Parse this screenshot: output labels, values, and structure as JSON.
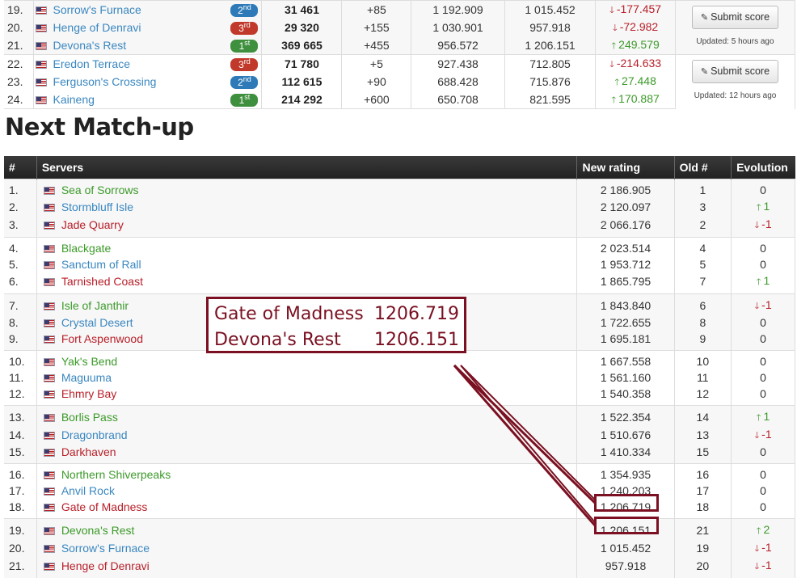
{
  "top_table": {
    "groups": [
      {
        "rows": [
          {
            "rank": "19.",
            "server": "Sorrow's Furnace",
            "color": "blue",
            "tier": "2",
            "tier_sup": "nd",
            "score": "31 461",
            "delta": "+85",
            "r1": "1 192.909",
            "r2": "1 015.452",
            "change": "-177.457",
            "dir": "down"
          },
          {
            "rank": "20.",
            "server": "Henge of Denravi",
            "color": "blue",
            "tier": "3",
            "tier_sup": "rd",
            "score": "29 320",
            "delta": "+155",
            "r1": "1 030.901",
            "r2": "957.918",
            "change": "-72.982",
            "dir": "down"
          },
          {
            "rank": "21.",
            "server": "Devona's Rest",
            "color": "blue",
            "tier": "1",
            "tier_sup": "st",
            "score": "369 665",
            "delta": "+455",
            "r1": "956.572",
            "r2": "1 206.151",
            "change": "249.579",
            "dir": "up"
          }
        ],
        "button": "Submit score",
        "updated": "Updated: 5 hours ago"
      },
      {
        "rows": [
          {
            "rank": "22.",
            "server": "Eredon Terrace",
            "color": "blue",
            "tier": "3",
            "tier_sup": "rd",
            "score": "71 780",
            "delta": "+5",
            "r1": "927.438",
            "r2": "712.805",
            "change": "-214.633",
            "dir": "down"
          },
          {
            "rank": "23.",
            "server": "Ferguson's Crossing",
            "color": "blue",
            "tier": "2",
            "tier_sup": "nd",
            "score": "112 615",
            "delta": "+90",
            "r1": "688.428",
            "r2": "715.876",
            "change": "27.448",
            "dir": "up"
          },
          {
            "rank": "24.",
            "server": "Kaineng",
            "color": "blue",
            "tier": "1",
            "tier_sup": "st",
            "score": "214 292",
            "delta": "+600",
            "r1": "650.708",
            "r2": "821.595",
            "change": "170.887",
            "dir": "up"
          }
        ],
        "button": "Submit score",
        "updated": "Updated: 12 hours ago"
      }
    ]
  },
  "next_matchup": {
    "title": "Next Match-up",
    "headers": {
      "num": "#",
      "servers": "Servers",
      "new_rating": "New rating",
      "old": "Old #",
      "evolution": "Evolution"
    },
    "groups": [
      [
        {
          "n": "1.",
          "server": "Sea of Sorrows",
          "color": "green",
          "rating": "2 186.905",
          "old": "1",
          "evo": "0",
          "dir": ""
        },
        {
          "n": "2.",
          "server": "Stormbluff Isle",
          "color": "blue",
          "rating": "2 120.097",
          "old": "3",
          "evo": "1",
          "dir": "up"
        },
        {
          "n": "3.",
          "server": "Jade Quarry",
          "color": "red",
          "rating": "2 066.176",
          "old": "2",
          "evo": "-1",
          "dir": "down"
        }
      ],
      [
        {
          "n": "4.",
          "server": "Blackgate",
          "color": "green",
          "rating": "2 023.514",
          "old": "4",
          "evo": "0",
          "dir": ""
        },
        {
          "n": "5.",
          "server": "Sanctum of Rall",
          "color": "blue",
          "rating": "1 953.712",
          "old": "5",
          "evo": "0",
          "dir": ""
        },
        {
          "n": "6.",
          "server": "Tarnished Coast",
          "color": "red",
          "rating": "1 865.795",
          "old": "7",
          "evo": "1",
          "dir": "up"
        }
      ],
      [
        {
          "n": "7.",
          "server": "Isle of Janthir",
          "color": "green",
          "rating": "1 843.840",
          "old": "6",
          "evo": "-1",
          "dir": "down"
        },
        {
          "n": "8.",
          "server": "Crystal Desert",
          "color": "blue",
          "rating": "1 722.655",
          "old": "8",
          "evo": "0",
          "dir": ""
        },
        {
          "n": "9.",
          "server": "Fort Aspenwood",
          "color": "red",
          "rating": "1 695.181",
          "old": "9",
          "evo": "0",
          "dir": ""
        }
      ],
      [
        {
          "n": "10.",
          "server": "Yak's Bend",
          "color": "green",
          "rating": "1 667.558",
          "old": "10",
          "evo": "0",
          "dir": ""
        },
        {
          "n": "11.",
          "server": "Maguuma",
          "color": "blue",
          "rating": "1 561.160",
          "old": "11",
          "evo": "0",
          "dir": ""
        },
        {
          "n": "12.",
          "server": "Ehmry Bay",
          "color": "red",
          "rating": "1 540.358",
          "old": "12",
          "evo": "0",
          "dir": ""
        }
      ],
      [
        {
          "n": "13.",
          "server": "Borlis Pass",
          "color": "green",
          "rating": "1 522.354",
          "old": "14",
          "evo": "1",
          "dir": "up"
        },
        {
          "n": "14.",
          "server": "Dragonbrand",
          "color": "blue",
          "rating": "1 510.676",
          "old": "13",
          "evo": "-1",
          "dir": "down"
        },
        {
          "n": "15.",
          "server": "Darkhaven",
          "color": "red",
          "rating": "1 410.334",
          "old": "15",
          "evo": "0",
          "dir": ""
        }
      ],
      [
        {
          "n": "16.",
          "server": "Northern Shiverpeaks",
          "color": "green",
          "rating": "1 354.935",
          "old": "16",
          "evo": "0",
          "dir": ""
        },
        {
          "n": "17.",
          "server": "Anvil Rock",
          "color": "blue",
          "rating": "1 240.203",
          "old": "17",
          "evo": "0",
          "dir": ""
        },
        {
          "n": "18.",
          "server": "Gate of Madness",
          "color": "red",
          "rating": "1 206.719",
          "old": "18",
          "evo": "0",
          "dir": ""
        }
      ],
      [
        {
          "n": "19.",
          "server": "Devona's Rest",
          "color": "green",
          "rating": "1 206.151",
          "old": "21",
          "evo": "2",
          "dir": "up"
        },
        {
          "n": "20.",
          "server": "Sorrow's Furnace",
          "color": "blue",
          "rating": "1 015.452",
          "old": "19",
          "evo": "-1",
          "dir": "down"
        },
        {
          "n": "21.",
          "server": "Henge of Denravi",
          "color": "red",
          "rating": "957.918",
          "old": "20",
          "evo": "-1",
          "dir": "down"
        }
      ]
    ]
  },
  "annotation": {
    "line1_label": "Gate of Madness",
    "line1_value": "1206.719",
    "line2_label": "Devona's Rest",
    "line2_value": "1206.151",
    "color": "#7a1021"
  }
}
